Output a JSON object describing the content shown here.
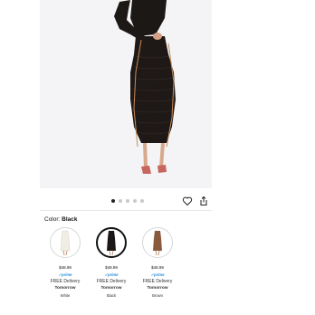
{
  "hero": {
    "image_alt": "Black ruched off-shoulder midi dress"
  },
  "pager": {
    "count": 5,
    "active": 0
  },
  "color": {
    "prefix": "Color:",
    "selected": "Black"
  },
  "swatches": [
    {
      "name": "White",
      "price": "$48.99",
      "prime": "✓prime",
      "delivery": "FREE Delivery",
      "when": "Tomorrow",
      "tone": "#f2ede4",
      "selected": false
    },
    {
      "name": "Black",
      "price": "$48.99",
      "prime": "✓prime",
      "delivery": "FREE Delivery",
      "when": "Tomorrow",
      "tone": "#1b1716",
      "selected": true
    },
    {
      "name": "Brown",
      "price": "$48.99",
      "prime": "✓prime",
      "delivery": "FREE Delivery",
      "when": "Tomorrow",
      "tone": "#8a5a3c",
      "selected": false
    }
  ]
}
